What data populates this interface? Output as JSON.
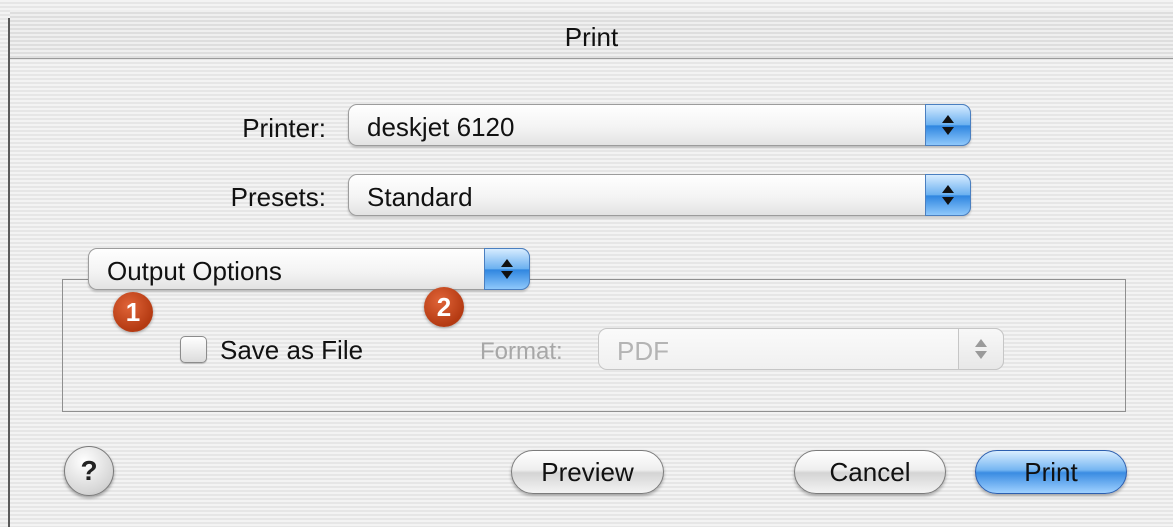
{
  "window": {
    "title": "Print"
  },
  "printer": {
    "label": "Printer:",
    "value": "deskjet 6120"
  },
  "presets": {
    "label": "Presets:",
    "value": "Standard"
  },
  "panel": {
    "value": "Output Options"
  },
  "badges": [
    "1",
    "2"
  ],
  "save_as_file": {
    "label": "Save as File",
    "checked": false
  },
  "format": {
    "label": "Format:",
    "value": "PDF",
    "enabled": false
  },
  "buttons": {
    "help": "?",
    "preview": "Preview",
    "cancel": "Cancel",
    "print": "Print"
  },
  "colors": {
    "accent": "#3a8ce2",
    "badge": "#c0451a"
  }
}
